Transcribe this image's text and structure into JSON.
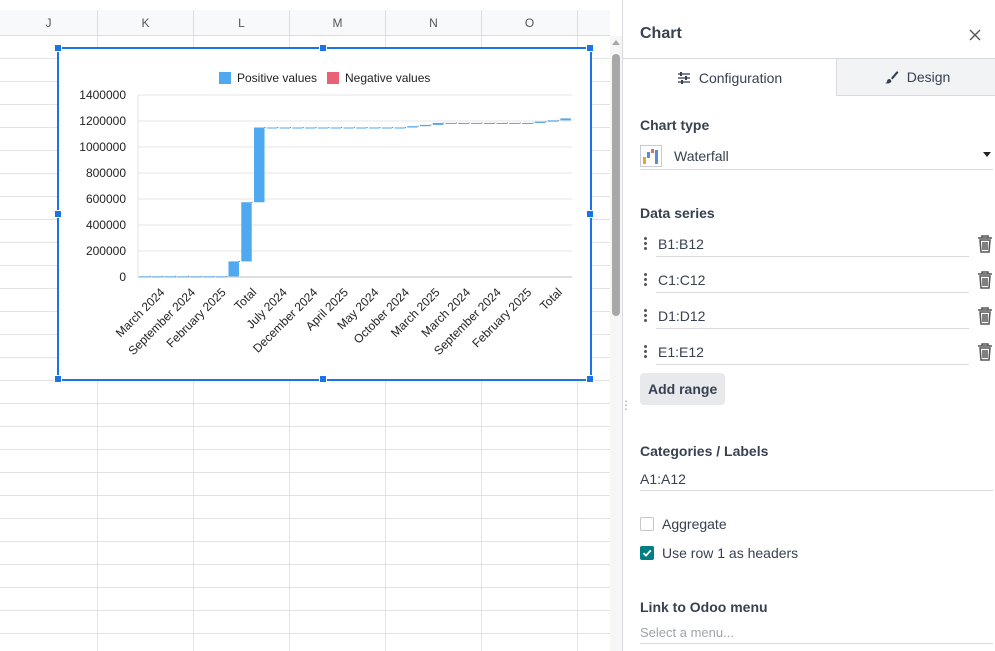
{
  "sheet": {
    "columns": [
      "J",
      "K",
      "L",
      "M",
      "N",
      "O"
    ]
  },
  "side_panel": {
    "title": "Chart",
    "tabs": [
      {
        "label": "Configuration",
        "icon": "sliders-icon"
      },
      {
        "label": "Design",
        "icon": "paintbrush-icon"
      }
    ],
    "chart_type_title": "Chart type",
    "chart_type_value": "Waterfall",
    "data_series_title": "Data series",
    "data_series": [
      "B1:B12",
      "C1:C12",
      "D1:D12",
      "E1:E12"
    ],
    "add_range_label": "Add range",
    "labels_title": "Categories / Labels",
    "labels_range": "A1:A12",
    "aggregate_label": "Aggregate",
    "aggregate_checked": false,
    "use_headers_label": "Use row 1 as headers",
    "use_headers_checked": true,
    "link_title": "Link to Odoo menu",
    "link_placeholder": "Select a menu..."
  },
  "colors": {
    "selection": "#1a73e8",
    "positive": "#4ea9f0",
    "negative": "#ea6175",
    "accent_teal": "#017e84"
  },
  "chart_data": {
    "type": "bar",
    "subtype": "waterfall",
    "legend": [
      {
        "name": "Positive values",
        "color": "#4ea9f0"
      },
      {
        "name": "Negative values",
        "color": "#ea6175"
      }
    ],
    "legend_position": "top",
    "ylim": [
      0,
      1400000
    ],
    "yticks": [
      0,
      200000,
      400000,
      600000,
      800000,
      1000000,
      1200000,
      1400000
    ],
    "x_labels": [
      "March 2024",
      "September 2024",
      "February 2025",
      "Total",
      "July 2024",
      "December 2024",
      "April 2025",
      "May 2024",
      "October 2024",
      "March 2025",
      "March 2024",
      "September 2024",
      "February 2025",
      "Total"
    ],
    "bars": [
      {
        "start": 0,
        "end": 5000
      },
      {
        "start": 5000,
        "end": 5000
      },
      {
        "start": 5000,
        "end": 5000
      },
      {
        "start": 5000,
        "end": 5000
      },
      {
        "start": 5000,
        "end": 5000
      },
      {
        "start": 5000,
        "end": 5000
      },
      {
        "start": 5000,
        "end": 5000
      },
      {
        "start": 5000,
        "end": 120000
      },
      {
        "start": 120000,
        "end": 575000
      },
      {
        "start": 575000,
        "end": 1150000
      },
      {
        "start": 1150000,
        "end": 1150000
      },
      {
        "start": 1150000,
        "end": 1150000
      },
      {
        "start": 1150000,
        "end": 1150000
      },
      {
        "start": 1150000,
        "end": 1150000
      },
      {
        "start": 1150000,
        "end": 1150000
      },
      {
        "start": 1150000,
        "end": 1150000
      },
      {
        "start": 1150000,
        "end": 1150000
      },
      {
        "start": 1150000,
        "end": 1150000
      },
      {
        "start": 1150000,
        "end": 1150000
      },
      {
        "start": 1150000,
        "end": 1150000
      },
      {
        "start": 1150000,
        "end": 1150000
      },
      {
        "start": 1150000,
        "end": 1160000
      },
      {
        "start": 1160000,
        "end": 1170000
      },
      {
        "start": 1170000,
        "end": 1185000
      },
      {
        "start": 1185000,
        "end": 1185000
      },
      {
        "start": 1185000,
        "end": 1185000
      },
      {
        "start": 1185000,
        "end": 1185000
      },
      {
        "start": 1185000,
        "end": 1185000
      },
      {
        "start": 1185000,
        "end": 1185000
      },
      {
        "start": 1185000,
        "end": 1185000
      },
      {
        "start": 1185000,
        "end": 1185000
      },
      {
        "start": 1185000,
        "end": 1195000
      },
      {
        "start": 1195000,
        "end": 1205000
      },
      {
        "start": 1205000,
        "end": 1220000
      }
    ]
  }
}
